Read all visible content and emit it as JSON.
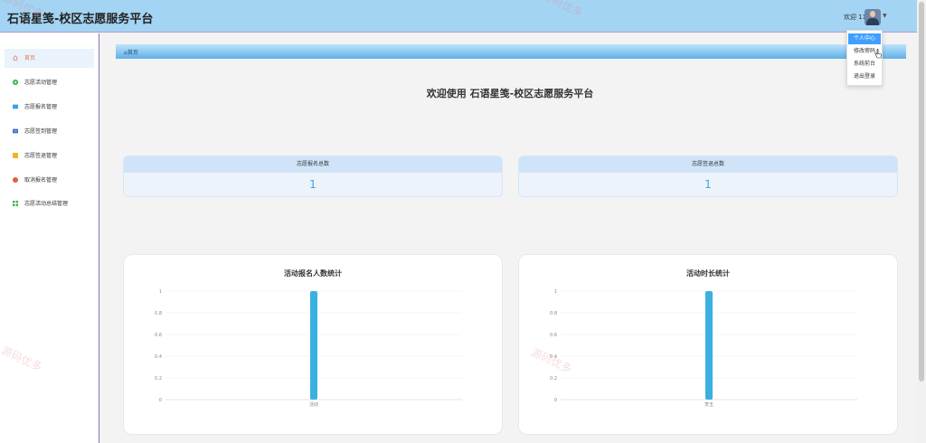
{
  "app": {
    "title": "石语星笺-校区志愿服务平台"
  },
  "header": {
    "welcome": "欢迎 11",
    "avatar_icon": "user-avatar",
    "caret_icon": "chevron-down-icon"
  },
  "user_menu": {
    "items": [
      {
        "label": "个人中心",
        "active": true
      },
      {
        "label": "修改密码",
        "active": false
      },
      {
        "label": "系统前台",
        "active": false
      },
      {
        "label": "退出登录",
        "active": false
      }
    ]
  },
  "sidebar": {
    "items": [
      {
        "label": "首页",
        "icon": "home-icon",
        "color": "#e07b5b",
        "active": true
      },
      {
        "label": "志愿活动管理",
        "icon": "activity-icon",
        "color": "#2cb34a"
      },
      {
        "label": "志愿报名管理",
        "icon": "signup-icon",
        "color": "#3aa0e8"
      },
      {
        "label": "志愿签到管理",
        "icon": "checkin-icon",
        "color": "#3d6cc8"
      },
      {
        "label": "志愿签退管理",
        "icon": "checkout-icon",
        "color": "#f0b429"
      },
      {
        "label": "取消报名管理",
        "icon": "cancel-icon",
        "color": "#e06040"
      },
      {
        "label": "志愿活动总结管理",
        "icon": "summary-icon",
        "color": "#2cb34a"
      }
    ]
  },
  "breadcrumb": {
    "home_icon": "home-icon",
    "label": "首页"
  },
  "main": {
    "title": "欢迎使用 石语星笺-校区志愿服务平台"
  },
  "stats": [
    {
      "label": "志愿报名总数",
      "value": "1"
    },
    {
      "label": "志愿签退总数",
      "value": "1"
    }
  ],
  "charts": {
    "accent": "#3ab0e0",
    "left_title": "活动报名人数统计",
    "right_title": "活动时长统计"
  },
  "chart_data": [
    {
      "type": "bar",
      "title": "活动报名人数统计",
      "categories": [
        "活动"
      ],
      "values": [
        1
      ],
      "ylim": [
        0,
        1
      ],
      "yticks": [
        "0",
        "0.2",
        "0.4",
        "0.6",
        "0.8",
        "1"
      ],
      "grid": true
    },
    {
      "type": "bar",
      "title": "活动时长统计",
      "categories": [
        "李玉"
      ],
      "values": [
        1
      ],
      "ylim": [
        0,
        1
      ],
      "yticks": [
        "0",
        "0.2",
        "0.4",
        "0.6",
        "0.8",
        "1"
      ],
      "grid": true
    }
  ],
  "watermark": "源码优多"
}
